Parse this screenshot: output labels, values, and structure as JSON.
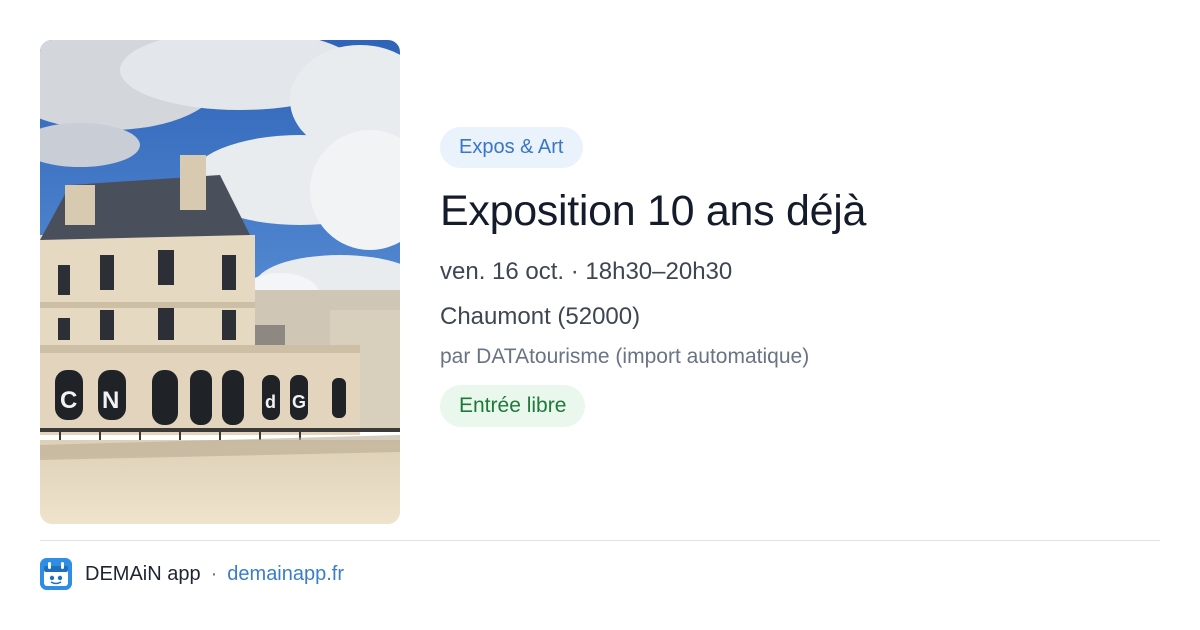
{
  "event": {
    "category": "Expos & Art",
    "title": "Exposition 10 ans déjà",
    "datetime": "ven. 16 oct. · 18h30–20h30",
    "location": "Chaumont (52000)",
    "source": "par DATAtourisme (import automatique)",
    "price": "Entrée libre",
    "image": {
      "subject": "building-photo",
      "letters": [
        "C",
        "N",
        "d",
        "G"
      ]
    }
  },
  "footer": {
    "app_name": "DEMAiN app",
    "separator": "·",
    "url": "demainapp.fr",
    "logo_icon": "demain-logo-icon"
  },
  "colors": {
    "category_chip_bg": "#eaf2fc",
    "category_chip_text": "#3a76c4",
    "price_chip_bg": "#e9f7ec",
    "price_chip_text": "#1e7a3a",
    "link": "#3a7ec9",
    "logo_bg": "#2f8de4"
  }
}
